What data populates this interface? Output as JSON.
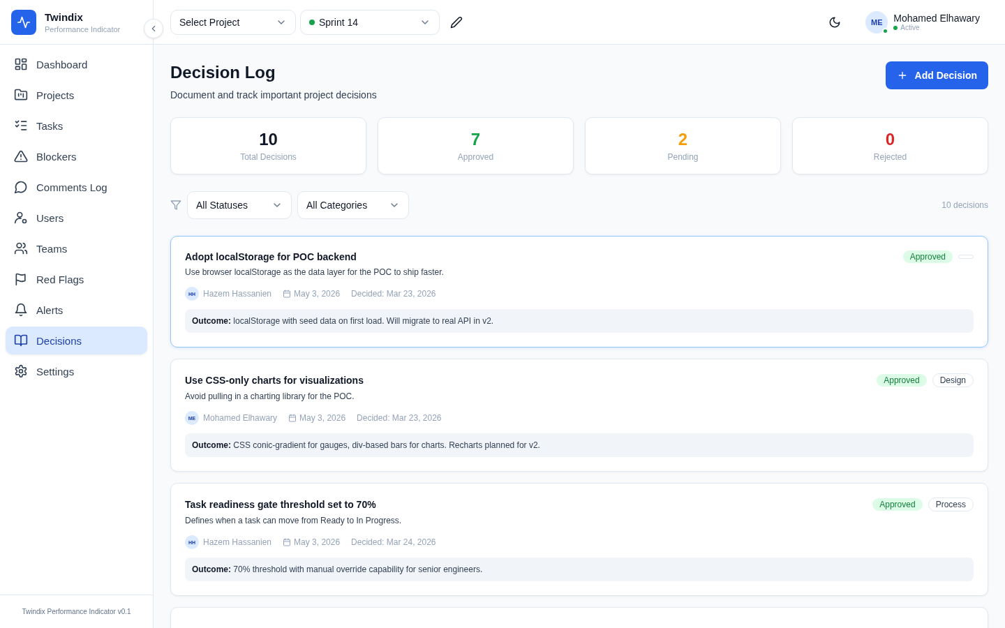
{
  "brand": {
    "name": "Twindix",
    "subtitle": "Performance Indicator"
  },
  "header": {
    "project_select": "Select Project",
    "sprint_select": "Sprint 14",
    "user": {
      "initials": "ME",
      "name": "Mohamed Elhawary",
      "status": "Active"
    }
  },
  "sidebar": {
    "items": [
      {
        "label": "Dashboard",
        "selected": false
      },
      {
        "label": "Projects",
        "selected": false
      },
      {
        "label": "Tasks",
        "selected": false
      },
      {
        "label": "Blockers",
        "selected": false
      },
      {
        "label": "Comments Log",
        "selected": false
      },
      {
        "label": "Users",
        "selected": false
      },
      {
        "label": "Teams",
        "selected": false
      },
      {
        "label": "Red Flags",
        "selected": false
      },
      {
        "label": "Alerts",
        "selected": false
      },
      {
        "label": "Decisions",
        "selected": true
      },
      {
        "label": "Settings",
        "selected": false
      }
    ],
    "footer": "Twindix Performance Indicator v0.1"
  },
  "page": {
    "title": "Decision Log",
    "subtitle": "Document and track important project decisions",
    "add_button": "Add Decision"
  },
  "stats": [
    {
      "value": "10",
      "label": "Total Decisions",
      "color": "#111827"
    },
    {
      "value": "7",
      "label": "Approved",
      "color": "#16a34a"
    },
    {
      "value": "2",
      "label": "Pending",
      "color": "#f59e0b"
    },
    {
      "value": "0",
      "label": "Rejected",
      "color": "#dc2626"
    }
  ],
  "filters": {
    "status": "All Statuses",
    "category": "All Categories",
    "count": "10 decisions"
  },
  "decisions": [
    {
      "kind": "full",
      "selected": true,
      "title": "Adopt localStorage for POC backend",
      "description": "Use browser localStorage as the data layer for the POC to ship faster.",
      "status": "Approved",
      "author_initials": "HH",
      "author": "Hazem Hassanien",
      "date": "May 3, 2026",
      "decided": "Decided: Mar 23, 2026",
      "outcome": "**Outcome:** localStorage with seed data on first load. Will migrate to real API in v2."
    },
    {
      "kind": "full",
      "selected": false,
      "title": "Use CSS-only charts for visualizations",
      "description": "Avoid pulling in a charting library for the POC.",
      "status": "Approved",
      "category": "Design",
      "author_initials": "ME",
      "author": "Mohamed Elhawary",
      "date": "May 3, 2026",
      "decided": "Decided: Mar 23, 2026",
      "outcome": "**Outcome:** CSS conic-gradient for gauges, div-based bars for charts. Recharts planned for v2."
    },
    {
      "kind": "full",
      "selected": false,
      "title": "Task readiness gate threshold set to 70%",
      "description": "Defines when a task can move from Ready to In Progress.",
      "status": "Approved",
      "category": "Process",
      "author_initials": "HH",
      "author": "Hazem Hassanien",
      "date": "May 3, 2026",
      "decided": "Decided: Mar 24, 2026",
      "outcome": "**Outcome:** 70% threshold with manual override capability for senior engineers."
    },
    {
      "kind": "cut",
      "selected": false
    }
  ]
}
